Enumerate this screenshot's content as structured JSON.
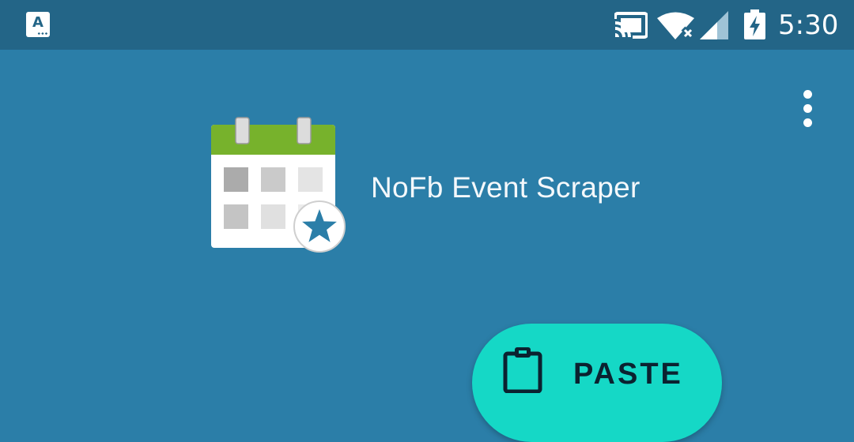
{
  "status_bar": {
    "time": "5:30",
    "app_notification_letter": "A",
    "icons": [
      "app-notification-icon",
      "cast-icon",
      "wifi-no-internet-icon",
      "cell-signal-icon",
      "battery-charging-icon"
    ]
  },
  "app": {
    "title": "NoFb Event Scraper",
    "logo_icon": "calendar-star-icon",
    "overflow_icon": "more-vert-icon"
  },
  "paste_button": {
    "label": "PASTE",
    "icon": "clipboard-icon"
  },
  "colors": {
    "background": "#2b7ea8",
    "status_bar": "#236587",
    "accent": "#15d8c6",
    "calendar_header": "#77b22c",
    "star": "#2b7ea8"
  }
}
